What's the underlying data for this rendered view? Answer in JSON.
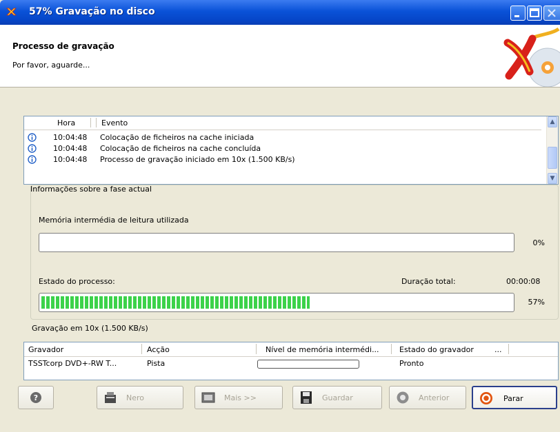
{
  "window": {
    "title": "57% Gravação no disco"
  },
  "header": {
    "title": "Processo de gravação",
    "subtitle": "Por favor, aguarde..."
  },
  "event_list": {
    "columns": [
      "Hora",
      "Evento"
    ],
    "rows": [
      {
        "time": "10:04:48",
        "event": "Colocação de ficheiros na cache iniciada",
        "icon": "info-icon"
      },
      {
        "time": "10:04:48",
        "event": "Colocação de ficheiros na cache concluída",
        "icon": "info-icon"
      },
      {
        "time": "10:04:48",
        "event": "Processo de gravação iniciado em 10x (1.500 KB/s)",
        "icon": "info-icon"
      }
    ]
  },
  "phase_group": {
    "legend": "Informações sobre a fase actual",
    "buffer_label": "Memória intermédia de leitura utilizada",
    "buffer_percent_text": "0%",
    "buffer_fraction": 0,
    "process_label": "Estado do processo:",
    "duration_label": "Duração total:",
    "duration_value": "00:00:08",
    "process_percent_text": "57%",
    "process_fraction": 0.57
  },
  "speed_label": "Gravação em 10x (1.500 KB/s)",
  "device_list": {
    "columns": [
      "Gravador",
      "Acção",
      "Nível de memória intermédi...",
      "Estado do gravador",
      "..."
    ],
    "rows": [
      {
        "recorder": "TSSTcorp DVD+-RW T...",
        "action": "Pista",
        "buffer_fraction": 0,
        "state": "Pronto"
      }
    ]
  },
  "buttons": {
    "nero": "Nero",
    "mais": "Mais >>",
    "guardar": "Guardar",
    "anterior": "Anterior",
    "parar": "Parar"
  },
  "colors": {
    "progress": "#3cd24a",
    "titlebar": "#0a52d8",
    "legend": "#0046d5"
  }
}
